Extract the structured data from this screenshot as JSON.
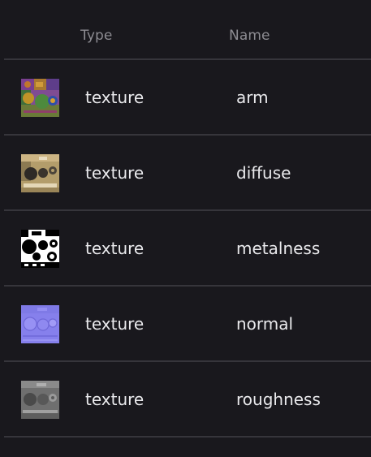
{
  "header": {
    "type_label": "Type",
    "name_label": "Name"
  },
  "rows": [
    {
      "type": "texture",
      "name": "arm",
      "thumbnail_icon": "arm-texture-thumbnail"
    },
    {
      "type": "texture",
      "name": "diffuse",
      "thumbnail_icon": "diffuse-texture-thumbnail"
    },
    {
      "type": "texture",
      "name": "metalness",
      "thumbnail_icon": "metalness-texture-thumbnail"
    },
    {
      "type": "texture",
      "name": "normal",
      "thumbnail_icon": "normal-texture-thumbnail"
    },
    {
      "type": "texture",
      "name": "roughness",
      "thumbnail_icon": "roughness-texture-thumbnail"
    }
  ],
  "colors": {
    "background": "#19181d",
    "separator": "#36353b",
    "header_text": "#8d8c92",
    "cell_text": "#e9e9ec"
  }
}
